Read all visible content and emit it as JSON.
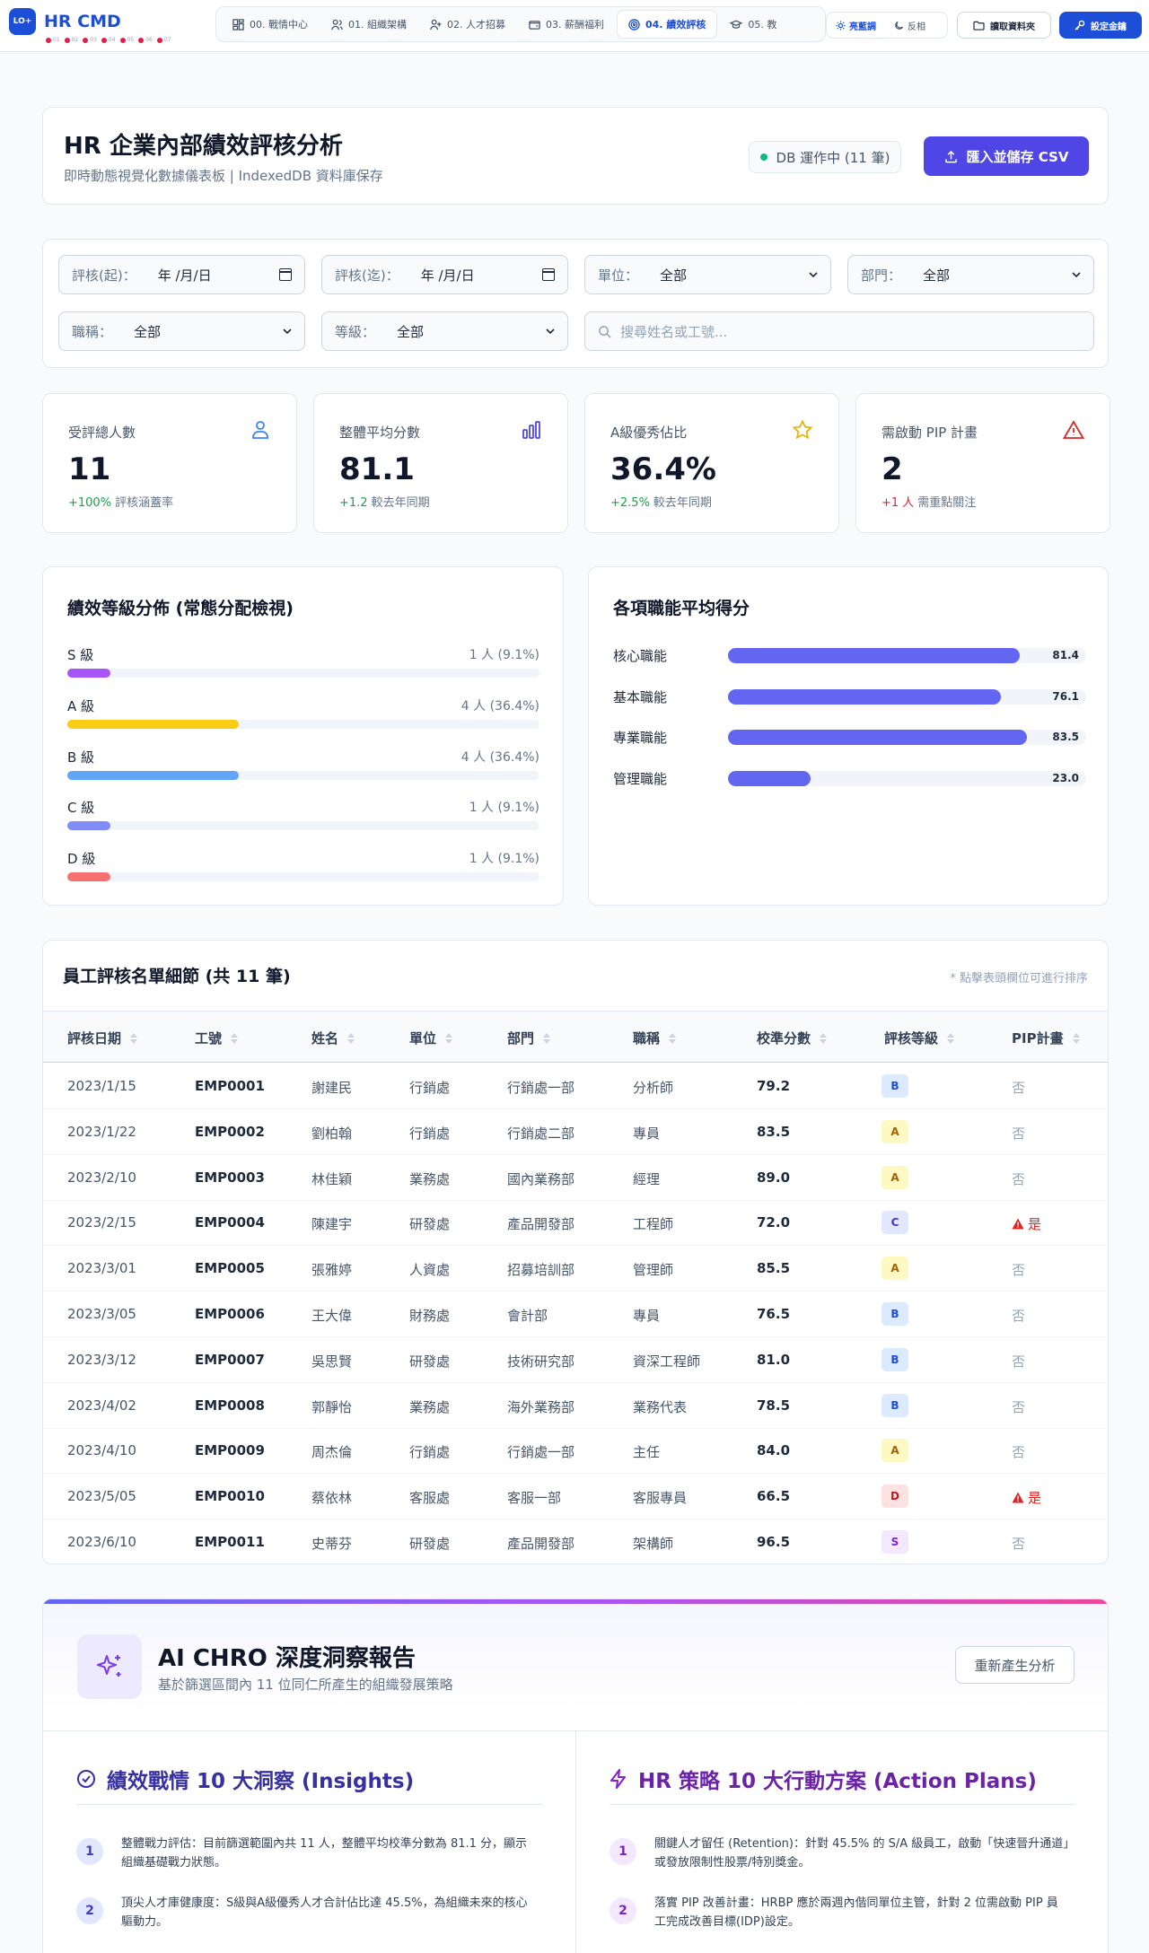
{
  "app": {
    "logo_badge": "LO+",
    "title": "HR CMD",
    "dots": [
      "01",
      "02",
      "03",
      "04",
      "05",
      "06",
      "07"
    ]
  },
  "nav": {
    "tabs": [
      {
        "label": "00. 戰情中心",
        "icon": "dashboard-icon"
      },
      {
        "label": "01. 組織架構",
        "icon": "users-icon"
      },
      {
        "label": "02. 人才招募",
        "icon": "user-plus-icon"
      },
      {
        "label": "03. 薪酬福利",
        "icon": "wallet-icon"
      },
      {
        "label": "04. 績效評核",
        "icon": "target-icon",
        "active": true
      },
      {
        "label": "05. 教",
        "icon": "graduation-icon"
      }
    ],
    "theme_light": "亮藍調",
    "theme_dark": "反相",
    "read_folder": "讀取資料夾",
    "set_key": "設定金鑰"
  },
  "header": {
    "title": "HR 企業內部績效評核分析",
    "subtitle": "即時動態視覺化數據儀表板 | IndexedDB 資料庫保存",
    "db_status": "DB 運作中 (11 筆)",
    "import_button": "匯入並儲存 CSV"
  },
  "filters": {
    "date_from_label": "評核(起)：",
    "date_from_value": "年 /月/日",
    "date_to_label": "評核(迄)：",
    "date_to_value": "年 /月/日",
    "unit_label": "單位：",
    "unit_value": "全部",
    "dept_label": "部門：",
    "dept_value": "全部",
    "title_label": "職稱：",
    "title_value": "全部",
    "grade_label": "等級：",
    "grade_value": "全部",
    "search_placeholder": "搜尋姓名或工號..."
  },
  "kpis": [
    {
      "label": "受評總人數",
      "value": "11",
      "delta": "+100%",
      "delta_type": "up",
      "note": "評核涵蓋率",
      "icon": "users-icon",
      "color": "#3b82f6"
    },
    {
      "label": "整體平均分數",
      "value": "81.1",
      "delta": "+1.2",
      "delta_type": "up",
      "note": "較去年同期",
      "icon": "bar-chart-icon",
      "color": "#4f46e5"
    },
    {
      "label": "A級優秀佔比",
      "value": "36.4%",
      "delta": "+2.5%",
      "delta_type": "up",
      "note": "較去年同期",
      "icon": "star-icon",
      "color": "#eab308"
    },
    {
      "label": "需啟動 PIP 計畫",
      "value": "2",
      "delta": "+1 人",
      "delta_type": "down",
      "note": "需重點關注",
      "icon": "alert-triangle-icon",
      "color": "#dc2626"
    }
  ],
  "distribution": {
    "title": "績效等級分佈 (常態分配檢視)",
    "rows": [
      {
        "label": "S 級",
        "value": "1 人 (9.1%)",
        "share": 0.091,
        "color": "#a855f7"
      },
      {
        "label": "A 級",
        "value": "4 人 (36.4%)",
        "share": 0.364,
        "color": "#facc15"
      },
      {
        "label": "B 級",
        "value": "4 人 (36.4%)",
        "share": 0.364,
        "color": "#60a5fa"
      },
      {
        "label": "C 級",
        "value": "1 人 (9.1%)",
        "share": 0.091,
        "color": "#818cf8"
      },
      {
        "label": "D 級",
        "value": "1 人 (9.1%)",
        "share": 0.091,
        "color": "#f87171"
      }
    ]
  },
  "skills": {
    "title": "各項職能平均得分",
    "rows": [
      {
        "label": "核心職能",
        "value": "81.4",
        "score": 81.4
      },
      {
        "label": "基本職能",
        "value": "76.1",
        "score": 76.1
      },
      {
        "label": "專業職能",
        "value": "83.5",
        "score": 83.5
      },
      {
        "label": "管理職能",
        "value": "23.0",
        "score": 23.0
      }
    ]
  },
  "table": {
    "title": "員工評核名單細節 (共 11 筆)",
    "hint": "* 點擊表頭欄位可進行排序",
    "columns": [
      "評核日期",
      "工號",
      "姓名",
      "單位",
      "部門",
      "職稱",
      "校準分數",
      "評核等級",
      "PIP計畫"
    ],
    "rows": [
      {
        "date": "2023/1/15",
        "id": "EMP0001",
        "name": "謝建民",
        "unit": "行銷處",
        "dept": "行銷處一部",
        "title": "分析師",
        "score": "79.2",
        "grade": "B",
        "pip": "否"
      },
      {
        "date": "2023/1/22",
        "id": "EMP0002",
        "name": "劉柏翰",
        "unit": "行銷處",
        "dept": "行銷處二部",
        "title": "專員",
        "score": "83.5",
        "grade": "A",
        "pip": "否"
      },
      {
        "date": "2023/2/10",
        "id": "EMP0003",
        "name": "林佳穎",
        "unit": "業務處",
        "dept": "國內業務部",
        "title": "經理",
        "score": "89.0",
        "grade": "A",
        "pip": "否"
      },
      {
        "date": "2023/2/15",
        "id": "EMP0004",
        "name": "陳建宇",
        "unit": "研發處",
        "dept": "產品開發部",
        "title": "工程師",
        "score": "72.0",
        "grade": "C",
        "pip": "是"
      },
      {
        "date": "2023/3/01",
        "id": "EMP0005",
        "name": "張雅婷",
        "unit": "人資處",
        "dept": "招募培訓部",
        "title": "管理師",
        "score": "85.5",
        "grade": "A",
        "pip": "否"
      },
      {
        "date": "2023/3/05",
        "id": "EMP0006",
        "name": "王大偉",
        "unit": "財務處",
        "dept": "會計部",
        "title": "專員",
        "score": "76.5",
        "grade": "B",
        "pip": "否"
      },
      {
        "date": "2023/3/12",
        "id": "EMP0007",
        "name": "吳思賢",
        "unit": "研發處",
        "dept": "技術研究部",
        "title": "資深工程師",
        "score": "81.0",
        "grade": "B",
        "pip": "否"
      },
      {
        "date": "2023/4/02",
        "id": "EMP0008",
        "name": "郭靜怡",
        "unit": "業務處",
        "dept": "海外業務部",
        "title": "業務代表",
        "score": "78.5",
        "grade": "B",
        "pip": "否"
      },
      {
        "date": "2023/4/10",
        "id": "EMP0009",
        "name": "周杰倫",
        "unit": "行銷處",
        "dept": "行銷處一部",
        "title": "主任",
        "score": "84.0",
        "grade": "A",
        "pip": "否"
      },
      {
        "date": "2023/5/05",
        "id": "EMP0010",
        "name": "蔡依林",
        "unit": "客服處",
        "dept": "客服一部",
        "title": "客服專員",
        "score": "66.5",
        "grade": "D",
        "pip": "是"
      },
      {
        "date": "2023/6/10",
        "id": "EMP0011",
        "name": "史蒂芬",
        "unit": "研發處",
        "dept": "產品開發部",
        "title": "架構師",
        "score": "96.5",
        "grade": "S",
        "pip": "否"
      }
    ],
    "grade_colors": {
      "S": {
        "bg": "#f3e8ff",
        "fg": "#7e22ce"
      },
      "A": {
        "bg": "#fef9c3",
        "fg": "#a16207"
      },
      "B": {
        "bg": "#dbeafe",
        "fg": "#1d4ed8"
      },
      "C": {
        "bg": "#e0e7ff",
        "fg": "#4338ca"
      },
      "D": {
        "bg": "#fee2e2",
        "fg": "#b91c1c"
      }
    }
  },
  "ai": {
    "title": "AI CHRO 深度洞察報告",
    "subtitle": "基於篩選區間內 11 位同仁所產生的組織發展策略",
    "regen_button": "重新產生分析",
    "insights_title": "績效戰情 10 大洞察 (Insights)",
    "actions_title": "HR 策略 10 大行動方案 (Action Plans)",
    "insights": [
      {
        "num": "1",
        "line1": "整體戰力評估：目前篩選範圍內共 11 人，整體平均校準分數為 81.1 分，顯示",
        "line2": "組織基礎戰力狀態。"
      },
      {
        "num": "2",
        "line1": "頂尖人才庫健康度：S級與A級優秀人才合計佔比達 45.5%，為組織未來的核心",
        "line2": "驅動力。"
      }
    ],
    "actions": [
      {
        "num": "1",
        "line1": "關鍵人才留任 (Retention)：針對 45.5% 的 S/A 級員工，啟動「快速晉升通道」",
        "line2": "或發放限制性股票/特別獎金。"
      },
      {
        "num": "2",
        "line1": "落實 PIP 改善計畫：HRBP 應於兩週內偕同單位主管，針對 2 位需啟動 PIP 員",
        "line2": "工完成改善目標(IDP)設定。"
      }
    ]
  }
}
